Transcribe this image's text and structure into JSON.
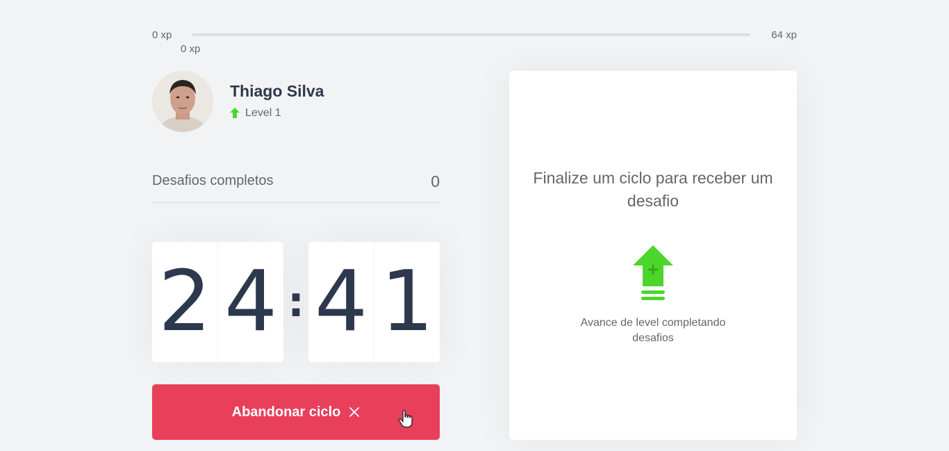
{
  "experience": {
    "min_label": "0 xp",
    "max_label": "64 xp",
    "current_label": "0 xp",
    "progress_fraction": 0
  },
  "profile": {
    "name": "Thiago Silva",
    "level_text": "Level 1",
    "level_icon": "level-up-arrow-icon"
  },
  "completed_challenges": {
    "label": "Desafios completos",
    "value": "0"
  },
  "countdown": {
    "minute_left": "2",
    "minute_right": "4",
    "separator": ":",
    "second_left": "4",
    "second_right": "1"
  },
  "abandon_button": {
    "label": "Abandonar ciclo",
    "icon": "close-icon"
  },
  "challenge_box": {
    "title": "Finalize um ciclo para receber um desafio",
    "hint": "Avance de level completando desafios",
    "icon": "level-up-icon"
  },
  "colors": {
    "background": "#f2f3f5",
    "text": "#666666",
    "title": "#2e384d",
    "green": "#4cd62b",
    "red": "#e83f5b",
    "white": "#ffffff"
  }
}
